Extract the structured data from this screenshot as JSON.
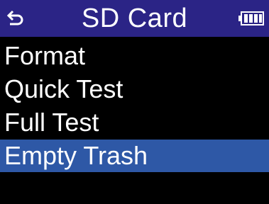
{
  "colors": {
    "background": "#000000",
    "header": "#2b2486",
    "selection": "#2e58a6",
    "text": "#ffffff"
  },
  "header": {
    "back_icon": "return-arrow-icon",
    "title": "SD Card",
    "battery_icon": "battery-icon"
  },
  "menu": {
    "items": [
      {
        "label": "Format",
        "selected": false
      },
      {
        "label": "Quick Test",
        "selected": false
      },
      {
        "label": "Full Test",
        "selected": false
      },
      {
        "label": "Empty Trash",
        "selected": true
      }
    ]
  }
}
